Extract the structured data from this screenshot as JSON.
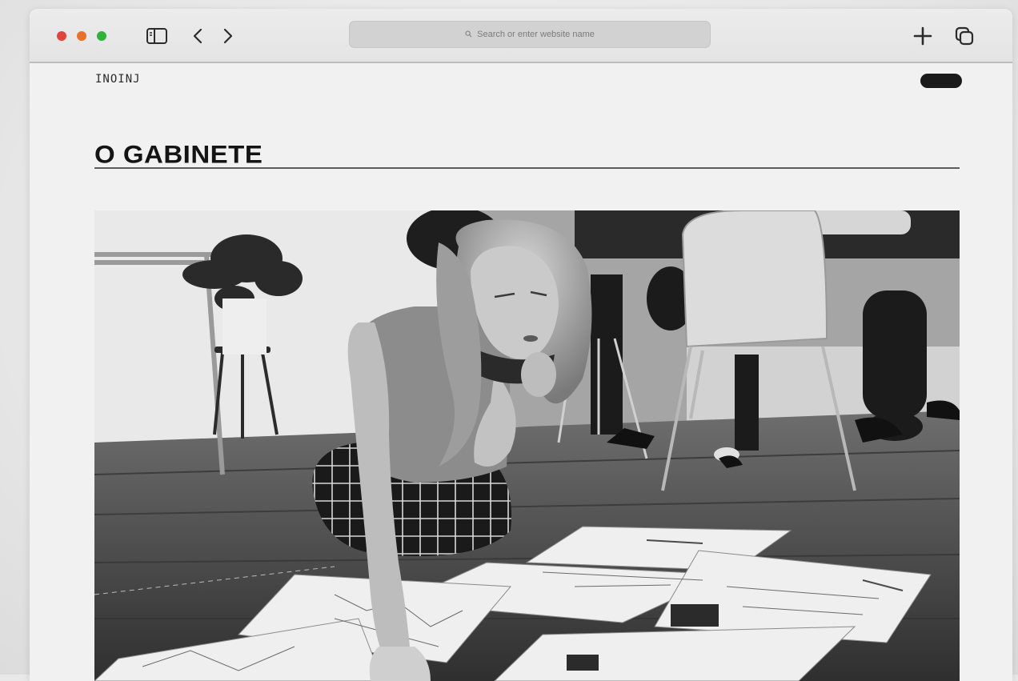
{
  "browser": {
    "address_placeholder": "Search or enter website name",
    "icons": [
      "sidebar-icon",
      "chevron-left-icon",
      "chevron-right-icon",
      "search-icon",
      "plus-icon",
      "tabs-icon"
    ]
  },
  "site": {
    "logo": "INOINJ",
    "eyebrow": "",
    "title": "O GABINETE",
    "intro": "",
    "menu_label": ""
  },
  "hero": {
    "image": "black-and-white photo of a woman kneeling on a wooden floor studying architectural drawings, with people seated on chairs in the background"
  },
  "colors": {
    "traffic_red": "#e0443e",
    "traffic_yellow": "#e8702a",
    "traffic_green": "#2fb33a",
    "title": "#141414",
    "pill": "#1a1a1a"
  }
}
